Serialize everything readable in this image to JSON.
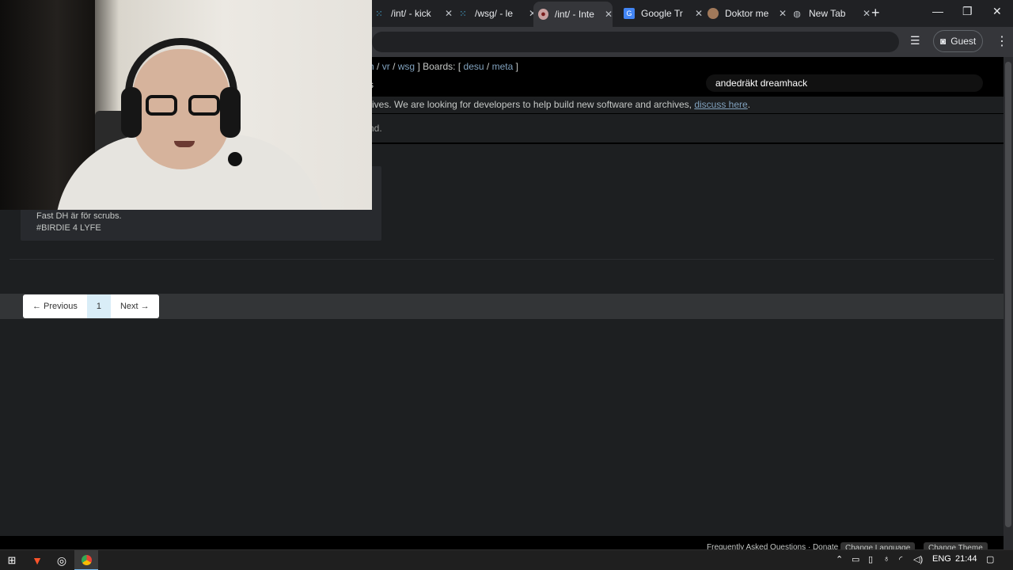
{
  "browser": {
    "tabs": [
      {
        "label": "/int/ - kick",
        "icon": "dots-favicon",
        "active": false
      },
      {
        "label": "/wsg/ - le",
        "icon": "dots-favicon",
        "active": false
      },
      {
        "label": "/int/ - Inte",
        "icon": "desu-favicon",
        "active": true
      },
      {
        "label": "Google Tr",
        "icon": "translate-favicon",
        "active": false
      },
      {
        "label": "Doktor me",
        "icon": "cookie-favicon",
        "active": false
      },
      {
        "label": "New Tab",
        "icon": "globe-favicon",
        "active": false
      }
    ],
    "new_tab_symbol": "+",
    "close_symbol": "✕",
    "profile_label": "Guest",
    "window_controls": {
      "minimize": "—",
      "maximize": "❐",
      "close": "✕"
    },
    "menu_symbol": "⋮",
    "media_symbol": "☰"
  },
  "page": {
    "boards_nav": {
      "prefix_fragment": "h",
      "links_a": [
        "vr",
        "wsg"
      ],
      "boards_label": "Boards:",
      "links_b": [
        "desu",
        "meta"
      ]
    },
    "nav_fragment": "s",
    "search_value": "andedräkt dreamhack",
    "notice_text": "rives. We are looking for developers to help build new software and archives, ",
    "notice_link": "discuss here",
    "notice_end": ".",
    "fragment_text": "nd.",
    "post": {
      "lines": [
        "Fast DH är för scrubs.",
        "#BIRDIE 4 LYFE"
      ]
    },
    "pagination": {
      "previous": "← Previous",
      "current": "1",
      "next": "Next →"
    },
    "footer": {
      "links": "Frequently Asked Questions · Donate",
      "change_language": "Change Language",
      "change_theme": "Change Theme"
    }
  },
  "taskbar": {
    "start_icon": "windows-logo",
    "apps": [
      "brave-icon",
      "obs-icon",
      "chrome-icon"
    ],
    "tray_language": "ENG",
    "clock": "21:44"
  },
  "colors": {
    "link": "#81a2be",
    "page_bg": "#1d1f21",
    "post_bg": "#282a2e",
    "current_page_bg": "#d9edf7"
  }
}
